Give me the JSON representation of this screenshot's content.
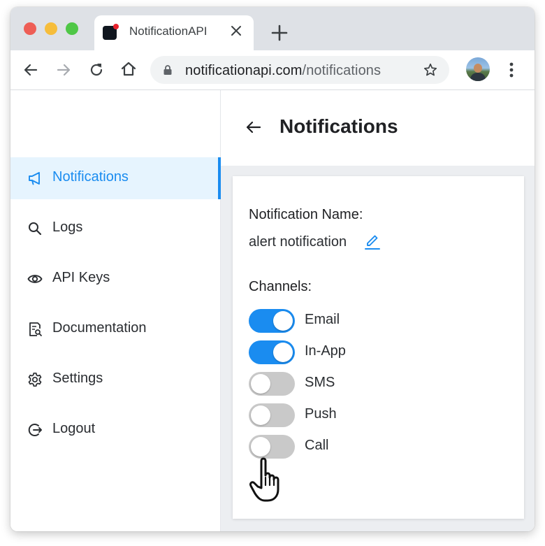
{
  "browser": {
    "tab_title": "NotificationAPI",
    "url_host": "notificationapi.com",
    "url_path": "/notifications",
    "icons": [
      "close-icon",
      "plus-icon",
      "back-icon",
      "forward-icon",
      "reload-icon",
      "home-icon",
      "lock-icon",
      "star-icon",
      "more-vert-icon"
    ]
  },
  "sidebar": {
    "items": [
      {
        "label": "Notifications",
        "icon": "megaphone-icon",
        "active": true
      },
      {
        "label": "Logs",
        "icon": "search-icon",
        "active": false
      },
      {
        "label": "API Keys",
        "icon": "eye-icon",
        "active": false
      },
      {
        "label": "Documentation",
        "icon": "document-search-icon",
        "active": false
      },
      {
        "label": "Settings",
        "icon": "gear-icon",
        "active": false
      },
      {
        "label": "Logout",
        "icon": "logout-icon",
        "active": false
      }
    ]
  },
  "main": {
    "title": "Notifications",
    "notification_name_label": "Notification Name:",
    "notification_name_value": "alert notification",
    "channels_label": "Channels:",
    "channels": [
      {
        "label": "Email",
        "enabled": true
      },
      {
        "label": "In-App",
        "enabled": true
      },
      {
        "label": "SMS",
        "enabled": false
      },
      {
        "label": "Push",
        "enabled": false
      },
      {
        "label": "Call",
        "enabled": false
      }
    ]
  },
  "colors": {
    "accent": "#1a8cf0",
    "active_nav_bg": "#e6f4fe",
    "toggle_off": "#c9c9c9",
    "main_bg": "#eceef1"
  }
}
